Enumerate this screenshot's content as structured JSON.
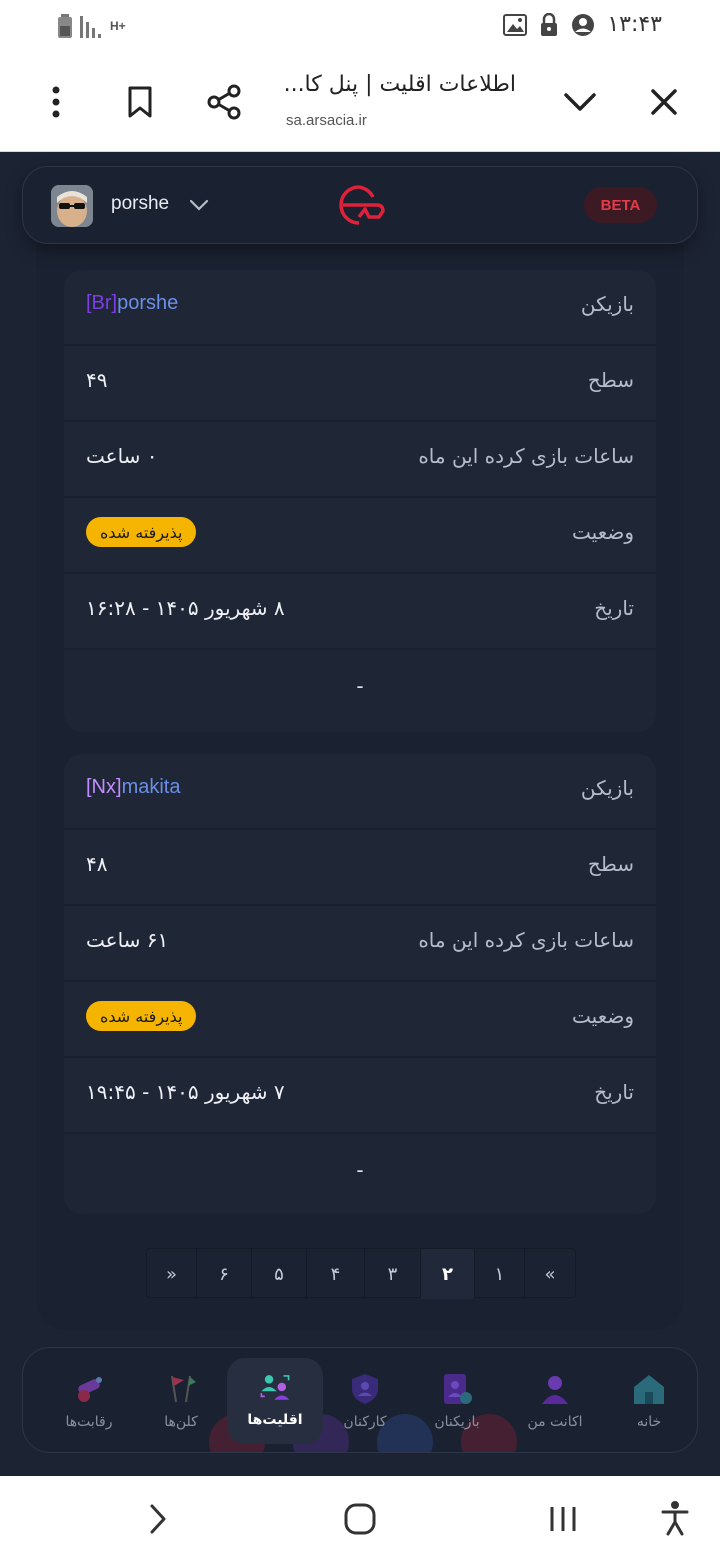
{
  "status_bar": {
    "time": "۱۳:۴۳",
    "network": "H+"
  },
  "browser": {
    "title": "اطلاعات اقلیت | پنل کا...",
    "url": "sa.arsacia.ir"
  },
  "header": {
    "username": "porshe",
    "beta_label": "BETA"
  },
  "records": [
    {
      "player_label": "بازیکن",
      "player_tag": "[Br]",
      "player_name": "porshe",
      "level_label": "سطح",
      "level": "۴۹",
      "hours_label": "ساعات بازی کرده این ماه",
      "hours": "۰ ساعت",
      "status_label": "وضعیت",
      "status": "پذیرفته شده",
      "date_label": "تاریخ",
      "date": "۸ شهریور ۱۴۰۵ - ۱۶:۲۸",
      "extra": "-"
    },
    {
      "player_label": "بازیکن",
      "player_tag": "[Nx]",
      "player_name": "makita",
      "level_label": "سطح",
      "level": "۴۸",
      "hours_label": "ساعات بازی کرده این ماه",
      "hours": "۶۱ ساعت",
      "status_label": "وضعیت",
      "status": "پذیرفته شده",
      "date_label": "تاریخ",
      "date": "۷ شهریور ۱۴۰۵ - ۱۹:۴۵",
      "extra": "-"
    }
  ],
  "pagination": {
    "prev": "«",
    "pages": [
      "۱",
      "۲",
      "۳",
      "۴",
      "۵",
      "۶"
    ],
    "next": "»",
    "current": "۲"
  },
  "bottom_nav": [
    {
      "label": "خانه",
      "icon": "home-icon"
    },
    {
      "label": "اکانت من",
      "icon": "user-icon"
    },
    {
      "label": "بازیکنان",
      "icon": "players-icon"
    },
    {
      "label": "کارکنان",
      "icon": "staff-shield-icon"
    },
    {
      "label": "اقلیت‌ها",
      "icon": "minorities-icon",
      "active": true
    },
    {
      "label": "کلن‌ها",
      "icon": "flags-icon"
    },
    {
      "label": "رقابت‌ها",
      "icon": "cannon-icon"
    }
  ],
  "colors": {
    "background": "#1c2333",
    "card": "#1f2636",
    "accent_red": "#e53a4a",
    "badge_yellow": "#f5b400",
    "player_blue": "#6b8fe6"
  }
}
